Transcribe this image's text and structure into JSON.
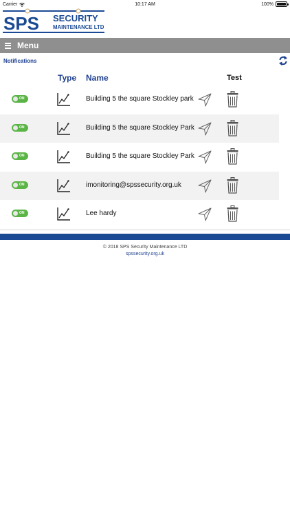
{
  "status_bar": {
    "carrier": "Carrier",
    "time": "10:17 AM",
    "battery": "100%"
  },
  "logo": {
    "primary": "SPS",
    "secondary_top": "SECURITY",
    "secondary_bottom": "MAINTENANCE LTD",
    "brand_blue": "#1b4a94"
  },
  "menu": {
    "label": "Menu",
    "background": "#8f8f8f"
  },
  "notifications": {
    "title": "Notifications"
  },
  "table": {
    "headers": {
      "type": "Type",
      "name": "Name",
      "test": "Test"
    },
    "rows": [
      {
        "enabled": true,
        "toggle_label": "ON",
        "type_icon": "line-chart-icon",
        "name": "Building 5 the square Stockley park"
      },
      {
        "enabled": true,
        "toggle_label": "ON",
        "type_icon": "line-chart-icon",
        "name": "Building 5 the square Stockley Park"
      },
      {
        "enabled": true,
        "toggle_label": "ON",
        "type_icon": "line-chart-icon",
        "name": "Building 5 the square Stockley Park"
      },
      {
        "enabled": true,
        "toggle_label": "ON",
        "type_icon": "line-chart-icon",
        "name": "imonitoring@spssecurity.org.uk"
      },
      {
        "enabled": true,
        "toggle_label": "ON",
        "type_icon": "line-chart-icon",
        "name": "Lee hardy"
      }
    ]
  },
  "footer": {
    "copyright": "© 2018 SPS Security Maintenance LTD",
    "link": "spssecurity.org.uk"
  },
  "colors": {
    "accent_blue": "#1c3f8f",
    "toggle_green": "#5bb546",
    "row_alt": "#f2f2f2"
  }
}
